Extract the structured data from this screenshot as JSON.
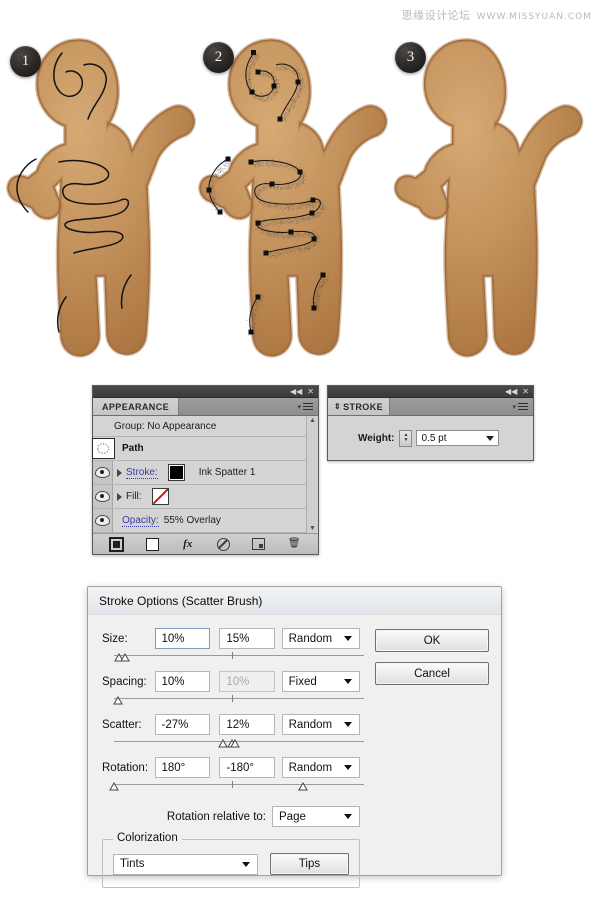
{
  "watermark": {
    "text": "思缘设计论坛",
    "url": "WWW.MISSYUAN.COM"
  },
  "figures": [
    {
      "badge": "1",
      "caption": "gingerbread-man-with-paths"
    },
    {
      "badge": "2",
      "caption": "gingerbread-man-with-scatter-brush"
    },
    {
      "badge": "3",
      "caption": "gingerbread-man-plain"
    }
  ],
  "appearance_panel": {
    "tab_label": "APPEARANCE",
    "menu_icon": "panel-menu-icon",
    "collapse_icon": "collapse-icon",
    "close_icon": "close-icon",
    "rows": [
      {
        "type": "group",
        "text": "Group: No Appearance"
      },
      {
        "type": "object",
        "label": "Path",
        "thumb": "path-thumb-icon"
      },
      {
        "type": "attr",
        "label": "Stroke:",
        "swatch": "black",
        "value": "Ink Spatter 1"
      },
      {
        "type": "attr",
        "label": "Fill:",
        "swatch": "none",
        "value": ""
      },
      {
        "type": "opacity",
        "label": "Opacity:",
        "value": "55% Overlay"
      }
    ],
    "footer_buttons": [
      {
        "name": "add-new-stroke-button",
        "icon": "stroke-icon"
      },
      {
        "name": "add-new-fill-button",
        "icon": "fill-icon"
      },
      {
        "name": "add-new-effect-button",
        "icon": "fx-icon",
        "label": "fx"
      },
      {
        "name": "clear-appearance-button",
        "icon": "clear-icon"
      },
      {
        "name": "duplicate-item-button",
        "icon": "duplicate-icon"
      },
      {
        "name": "delete-item-button",
        "icon": "trash-icon"
      }
    ]
  },
  "stroke_panel": {
    "tab_label": "STROKE",
    "weight_label": "Weight:",
    "weight_value": "0.5 pt",
    "menu_icon": "panel-menu-icon",
    "collapse_icon": "collapse-icon",
    "close_icon": "close-icon"
  },
  "dialog": {
    "title": "Stroke Options (Scatter Brush)",
    "fields": [
      {
        "label": "Size:",
        "value1": "10%",
        "value2": "15%",
        "mode": "Random",
        "v2_disabled": false
      },
      {
        "label": "Spacing:",
        "value1": "10%",
        "value2": "10%",
        "mode": "Fixed",
        "v2_disabled": true
      },
      {
        "label": "Scatter:",
        "value1": "-27%",
        "value2": "12%",
        "mode": "Random",
        "v2_disabled": false
      },
      {
        "label": "Rotation:",
        "value1": "180°",
        "value2": "-180°",
        "mode": "Random",
        "v2_disabled": false
      }
    ],
    "rotation_relative_label": "Rotation relative to:",
    "rotation_relative_value": "Page",
    "colorization_legend": "Colorization",
    "colorization_value": "Tints",
    "tips_button": "Tips",
    "ok_button": "OK",
    "cancel_button": "Cancel"
  },
  "colors": {
    "gingerbread_light": "#d4a06a",
    "gingerbread_mid": "#c08a55",
    "gingerbread_dark": "#a8703c",
    "stroke_black": "#111111",
    "panel_bg": "#d4d4d4",
    "dialog_bg": "#f0f0f0",
    "link_blue": "#3c3c9e"
  }
}
